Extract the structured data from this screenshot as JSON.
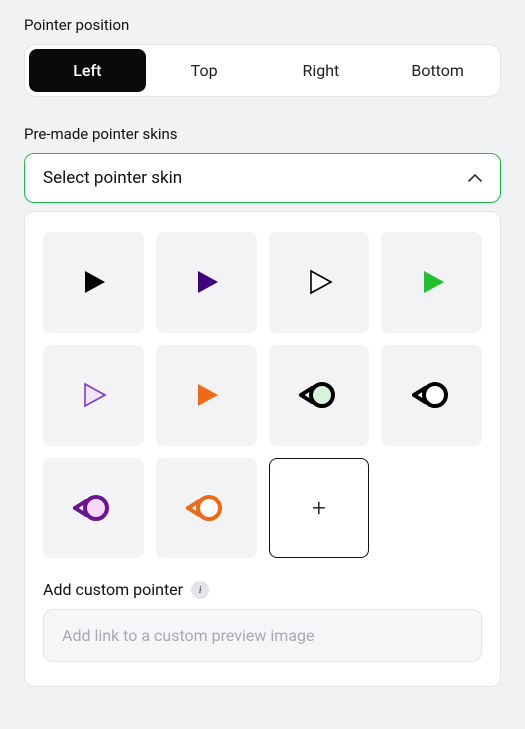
{
  "position": {
    "label": "Pointer position",
    "options": [
      "Left",
      "Top",
      "Right",
      "Bottom"
    ],
    "active": 0
  },
  "skins": {
    "label": "Pre-made pointer skins",
    "dropdown_label": "Select pointer skin",
    "grid": [
      {
        "type": "triangle",
        "fill": "#000000",
        "stroke": "none"
      },
      {
        "type": "triangle",
        "fill": "#3e027f",
        "stroke": "none"
      },
      {
        "type": "triangle",
        "fill": "#ffffff",
        "stroke": "#000000"
      },
      {
        "type": "triangle",
        "fill": "#1fbf2e",
        "stroke": "none"
      },
      {
        "type": "triangle",
        "fill": "#f3e4ff",
        "stroke": "#7d3dbf"
      },
      {
        "type": "triangle",
        "fill": "#ed6b17",
        "stroke": "none"
      },
      {
        "type": "bubble",
        "fill": "#d7f3de",
        "stroke": "#000000"
      },
      {
        "type": "bubble",
        "fill": "#ffffff",
        "stroke": "#000000"
      },
      {
        "type": "bubble",
        "fill": "#f3d8f8",
        "stroke": "#6a148f"
      },
      {
        "type": "bubble",
        "fill": "#ffffff",
        "stroke": "#ed6b17"
      },
      {
        "type": "add"
      }
    ]
  },
  "custom": {
    "label": "Add custom pointer",
    "placeholder": "Add link to a custom preview image",
    "info_label": "i"
  }
}
